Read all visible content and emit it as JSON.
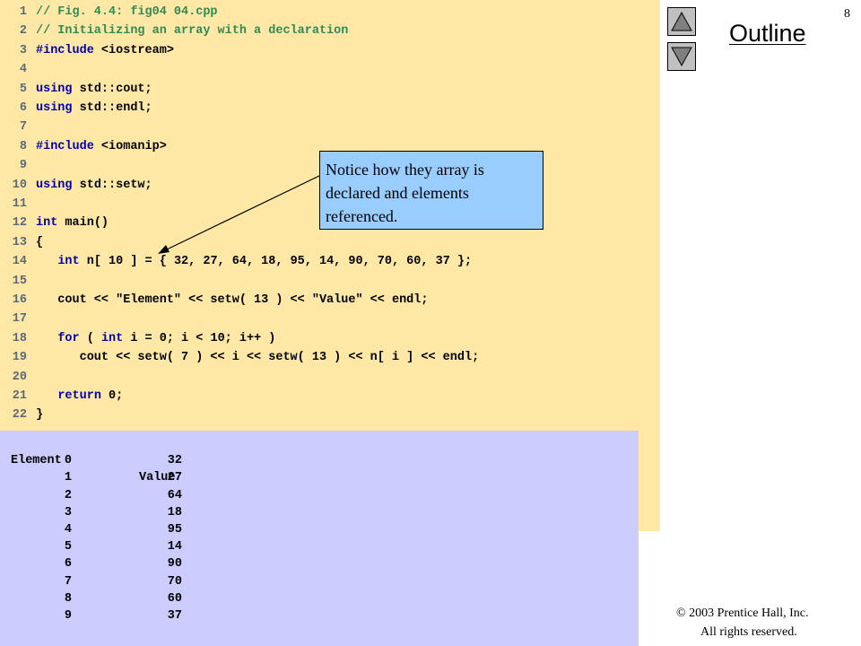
{
  "slide": {
    "page_number": "8",
    "outline_title": "Outline",
    "nav_up_icon": "triangle-up-icon",
    "nav_down_icon": "triangle-down-icon",
    "copyright_line1": "© 2003 Prentice Hall, Inc.",
    "copyright_line2": "All rights reserved."
  },
  "code": {
    "lines": [
      {
        "n": "1",
        "segments": [
          {
            "t": "// Fig. 4.4: fig04 04.cpp",
            "c": "cmt"
          }
        ]
      },
      {
        "n": "2",
        "segments": [
          {
            "t": "// Initializing an array with a declaration",
            "c": "cmt"
          }
        ]
      },
      {
        "n": "3",
        "segments": [
          {
            "t": "#include",
            "c": "kw"
          },
          {
            "t": " <iostream>",
            "c": ""
          }
        ]
      },
      {
        "n": "4",
        "segments": []
      },
      {
        "n": "5",
        "segments": [
          {
            "t": "using",
            "c": "kw"
          },
          {
            "t": " std::cout;",
            "c": ""
          }
        ]
      },
      {
        "n": "6",
        "segments": [
          {
            "t": "using",
            "c": "kw"
          },
          {
            "t": " std::endl;",
            "c": ""
          }
        ]
      },
      {
        "n": "7",
        "segments": []
      },
      {
        "n": "8",
        "segments": [
          {
            "t": "#include",
            "c": "kw"
          },
          {
            "t": " <iomanip>",
            "c": ""
          }
        ]
      },
      {
        "n": "9",
        "segments": []
      },
      {
        "n": "10",
        "segments": [
          {
            "t": "using",
            "c": "kw"
          },
          {
            "t": " std::setw;",
            "c": ""
          }
        ]
      },
      {
        "n": "11",
        "segments": []
      },
      {
        "n": "12",
        "segments": [
          {
            "t": "int",
            "c": "kw"
          },
          {
            "t": " main()",
            "c": ""
          }
        ]
      },
      {
        "n": "13",
        "segments": [
          {
            "t": "{",
            "c": ""
          }
        ]
      },
      {
        "n": "14",
        "segments": [
          {
            "t": "   ",
            "c": ""
          },
          {
            "t": "int",
            "c": "kw"
          },
          {
            "t": " n[ 10 ] = { 32, 27, 64, 18, 95, 14, 90, 70, 60, 37 };",
            "c": ""
          }
        ]
      },
      {
        "n": "15",
        "segments": []
      },
      {
        "n": "16",
        "segments": [
          {
            "t": "   cout << \"Element\" << setw( 13 ) << \"Value\" << endl;",
            "c": ""
          }
        ]
      },
      {
        "n": "17",
        "segments": []
      },
      {
        "n": "18",
        "segments": [
          {
            "t": "   ",
            "c": ""
          },
          {
            "t": "for",
            "c": "kw"
          },
          {
            "t": " ( ",
            "c": ""
          },
          {
            "t": "int",
            "c": "kw"
          },
          {
            "t": " i = 0; i < 10; i++ )",
            "c": ""
          }
        ]
      },
      {
        "n": "19",
        "segments": [
          {
            "t": "      cout << setw( 7 ) << i << setw( 13 ) << n[ i ] << endl;",
            "c": ""
          }
        ]
      },
      {
        "n": "20",
        "segments": []
      },
      {
        "n": "21",
        "segments": [
          {
            "t": "   ",
            "c": ""
          },
          {
            "t": "return",
            "c": "kw"
          },
          {
            "t": " 0;",
            "c": ""
          }
        ]
      },
      {
        "n": "22",
        "segments": [
          {
            "t": "}",
            "c": ""
          }
        ]
      }
    ]
  },
  "callout": {
    "text": "Notice how they array is declared and elements referenced."
  },
  "output": {
    "header_element": "Element",
    "header_value": "Value",
    "rows": [
      [
        "0",
        "32"
      ],
      [
        "1",
        "27"
      ],
      [
        "2",
        "64"
      ],
      [
        "3",
        "18"
      ],
      [
        "4",
        "95"
      ],
      [
        "5",
        "14"
      ],
      [
        "6",
        "90"
      ],
      [
        "7",
        "70"
      ],
      [
        "8",
        "60"
      ],
      [
        "9",
        "37"
      ]
    ]
  },
  "colors": {
    "code_background": "#ffe8a6",
    "output_background": "#ccccff",
    "callout_background": "#99ccff",
    "comment": "#2e8b57",
    "keyword": "#0000aa"
  }
}
